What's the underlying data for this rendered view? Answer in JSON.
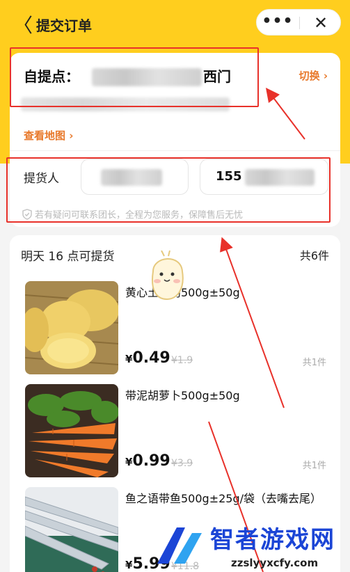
{
  "header": {
    "back_glyph": "〈",
    "title": "提交订单",
    "more_glyph": "•••",
    "close_glyph": "✕"
  },
  "address": {
    "pickup_label": "自提点：",
    "pickup_name_tail": "西门",
    "switch_label": "切换",
    "map_label": "查看地图"
  },
  "picker": {
    "label": "提货人",
    "phone_prefix": "155",
    "notice": "若有疑问可联系团长，全程为您服务，保障售后无忧"
  },
  "order": {
    "pickup_time": "明天 16 点可提货",
    "total_count": "共6件",
    "items": [
      {
        "name": "黄心土豆约500g±50g",
        "currency": "¥",
        "price": "0.49",
        "orig_price": "¥1.9",
        "qty": "共1件"
      },
      {
        "name": "带泥胡萝卜500g±50g",
        "currency": "¥",
        "price": "0.99",
        "orig_price": "¥3.9",
        "qty": "共1件"
      },
      {
        "name": "鱼之语带鱼500g±25g/袋（去嘴去尾）",
        "currency": "¥",
        "price": "5.99",
        "orig_price": "¥11.8",
        "qty": ""
      }
    ]
  },
  "watermark": {
    "brand": "智者游戏网",
    "url": "zzslyyxcfy.com"
  },
  "colors": {
    "brand_yellow": "#ffce1e",
    "accent_orange": "#e8792b",
    "highlight_red": "#e8312a"
  }
}
